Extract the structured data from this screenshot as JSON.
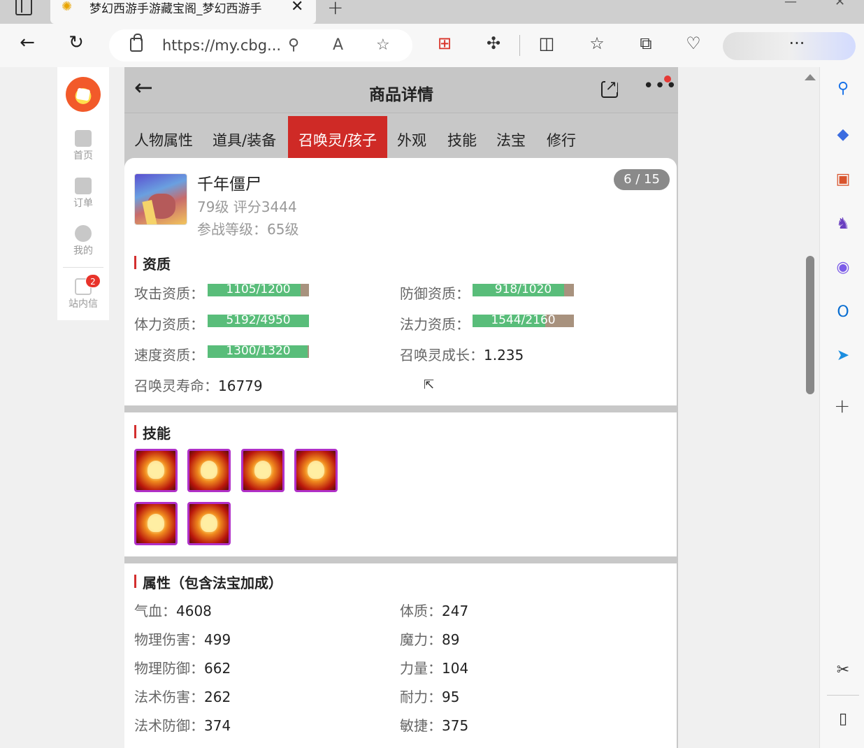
{
  "browser": {
    "tab": {
      "title": "梦幻西游手游藏宝阁_梦幻西游手",
      "close": "✕"
    },
    "new_tab": "+",
    "window_controls": {
      "minimize": "—",
      "close": "✕"
    },
    "address": {
      "url": "https://my.cbg..."
    },
    "icons": [
      "back-icon",
      "refresh-icon",
      "lock-icon",
      "zoom-icon",
      "read-aloud-icon",
      "favorite-icon",
      "ext-red-icon",
      "extensions-icon",
      "split-screen-icon",
      "favorites-icon",
      "collections-icon",
      "health-icon",
      "more-icon",
      "copilot-icon"
    ],
    "toolbar_glyphs": {
      "back": "←",
      "refresh": "↻",
      "zoom": "⚲",
      "read": "A",
      "star": "☆",
      "ext_red": "⊞",
      "puzzle": "✣",
      "split": "◫",
      "favs": "☆",
      "collect": "⧉",
      "health": "♡",
      "more": "···"
    }
  },
  "edge_sidebar": {
    "items": [
      {
        "name": "search",
        "glyph": "⚲",
        "color": "#1a73e8"
      },
      {
        "name": "shopping",
        "glyph": "◆",
        "color": "#3b6ce0"
      },
      {
        "name": "tools",
        "glyph": "▣",
        "color": "#d9532c"
      },
      {
        "name": "games",
        "glyph": "♞",
        "color": "#6a3fc0"
      },
      {
        "name": "office",
        "glyph": "◉",
        "color": "#7b5be8"
      },
      {
        "name": "outlook",
        "glyph": "O",
        "color": "#0a6ed1"
      },
      {
        "name": "send",
        "glyph": "➤",
        "color": "#1c8ee0"
      }
    ],
    "add": "+",
    "screenshot_glyph": "✂",
    "panel_glyph": "▯"
  },
  "site_nav": {
    "items": [
      {
        "label": "首页"
      },
      {
        "label": "订单"
      },
      {
        "label": "我的"
      },
      {
        "label": "站内信",
        "badge": "2"
      }
    ]
  },
  "panel": {
    "title": "商品详情",
    "back": "←",
    "more": "•••",
    "tabs": [
      "人物属性",
      "道具/装备",
      "召唤灵/孩子",
      "外观",
      "技能",
      "法宝",
      "修行"
    ],
    "active_tab": 2
  },
  "pet": {
    "name": "千年僵尸",
    "level_score": "79级 评分3444",
    "battle_level": "参战等级：65级",
    "pager": "6 / 15"
  },
  "aptitude": {
    "title": "资质",
    "bars": [
      {
        "label": "攻击资质：",
        "text": "1105/1200",
        "fill": 0.92
      },
      {
        "label": "防御资质：",
        "text": "918/1020",
        "fill": 0.9
      },
      {
        "label": "体力资质：",
        "text": "5192/4950",
        "fill": 1.0
      },
      {
        "label": "法力资质：",
        "text": "1544/2160",
        "fill": 0.715
      },
      {
        "label": "速度资质：",
        "text": "1300/1320",
        "fill": 0.985
      }
    ],
    "growth": {
      "label": "召唤灵成长：",
      "value": "1.235"
    },
    "lifespan": {
      "label": "召唤灵寿命：",
      "value": "16779"
    }
  },
  "skills": {
    "title": "技能",
    "items": [
      "skill-1",
      "skill-2",
      "skill-3",
      "skill-4",
      "skill-5",
      "skill-6"
    ]
  },
  "attributes": {
    "title": "属性（包含法宝加成）",
    "left": [
      {
        "label": "气血：",
        "value": "4608"
      },
      {
        "label": "物理伤害：",
        "value": "499"
      },
      {
        "label": "物理防御：",
        "value": "662"
      },
      {
        "label": "法术伤害：",
        "value": "262"
      },
      {
        "label": "法术防御：",
        "value": "374"
      }
    ],
    "right": [
      {
        "label": "体质：",
        "value": "247"
      },
      {
        "label": "魔力：",
        "value": "89"
      },
      {
        "label": "力量：",
        "value": "104"
      },
      {
        "label": "耐力：",
        "value": "95"
      },
      {
        "label": "敏捷：",
        "value": "375"
      }
    ]
  },
  "colors": {
    "accent_red": "#cf2a26",
    "bar_green": "#59bd7a",
    "bar_remaining": "#a8927e"
  }
}
